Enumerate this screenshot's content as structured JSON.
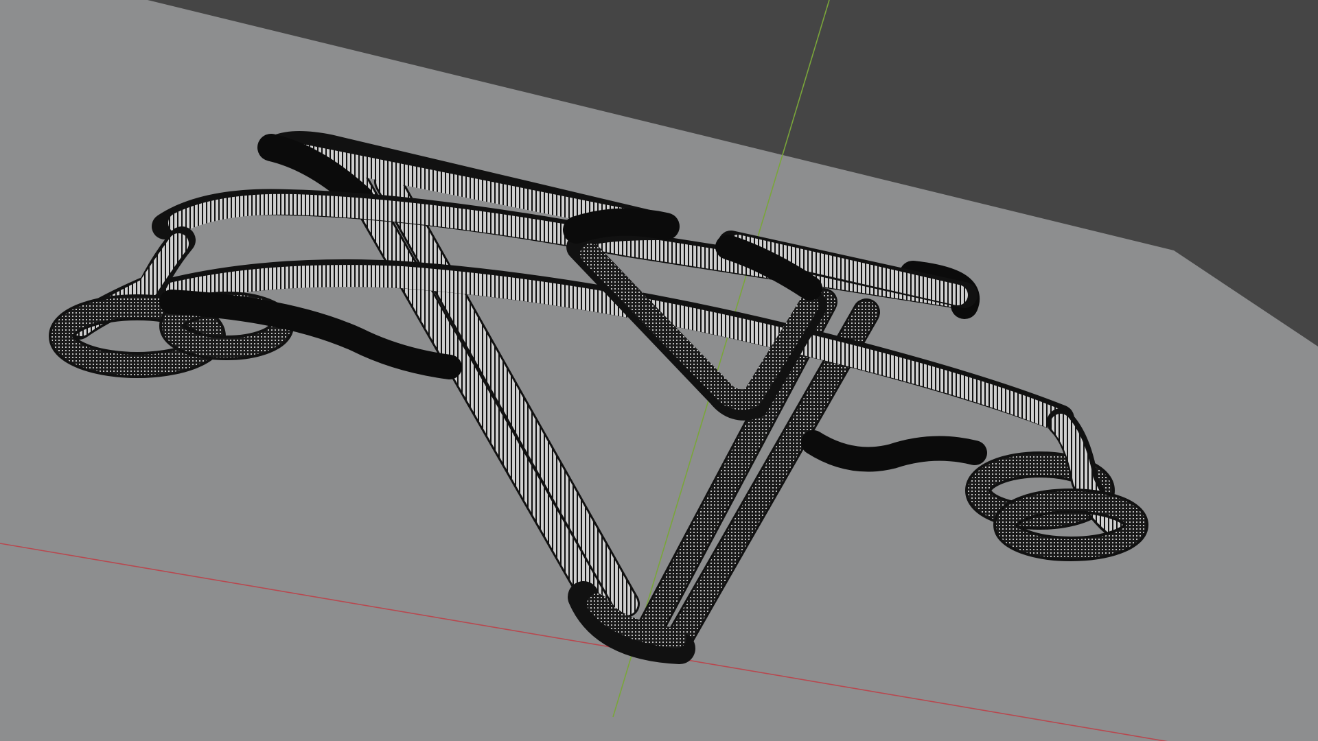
{
  "viewport": {
    "mode": "3d-wireframe-view",
    "colors": {
      "background": "#454545",
      "ground_plane": "#8c8d8e",
      "x_axis": "#b8484f",
      "y_axis": "#7aa63a",
      "wire_dark": "#0d0d0d",
      "wire_light": "#d7d7d7",
      "wire_edge": "#111111"
    },
    "objects": [
      {
        "name": "pipe-curve-mesh",
        "kind": "wireframe-tube"
      }
    ],
    "axes": [
      "x-axis-line",
      "y-axis-line"
    ]
  }
}
